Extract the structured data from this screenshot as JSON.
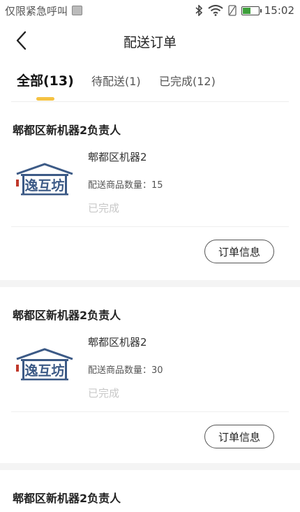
{
  "status_bar": {
    "carrier": "仅限紧急呼叫",
    "time": "15:02",
    "battery_level": 0.55,
    "icons": [
      "app-notification-icon",
      "bluetooth-icon",
      "wifi-icon",
      "no-sim-icon",
      "battery-icon"
    ]
  },
  "header": {
    "title": "配送订单",
    "back_icon": "chevron-left-icon"
  },
  "tabs": [
    {
      "label": "全部(13)",
      "active": true
    },
    {
      "label": "待配送(1)",
      "active": false
    },
    {
      "label": "已完成(12)",
      "active": false
    }
  ],
  "colors": {
    "accent": "#f5c242",
    "logo_blue": "#3c5a86",
    "logo_red": "#c0392b",
    "status_gray": "#c8c8c8"
  },
  "logo": {
    "text": "逸互坊",
    "icon": "store-logo-icon"
  },
  "orders": [
    {
      "owner": "郫都区新机器2负责人",
      "product": "郫都区机器2",
      "qty_label": "配送商品数量：",
      "qty": "15",
      "status": "已完成",
      "button": "订单信息"
    },
    {
      "owner": "郫都区新机器2负责人",
      "product": "郫都区机器2",
      "qty_label": "配送商品数量：",
      "qty": "30",
      "status": "已完成",
      "button": "订单信息"
    },
    {
      "owner": "郫都区新机器2负责人"
    }
  ]
}
